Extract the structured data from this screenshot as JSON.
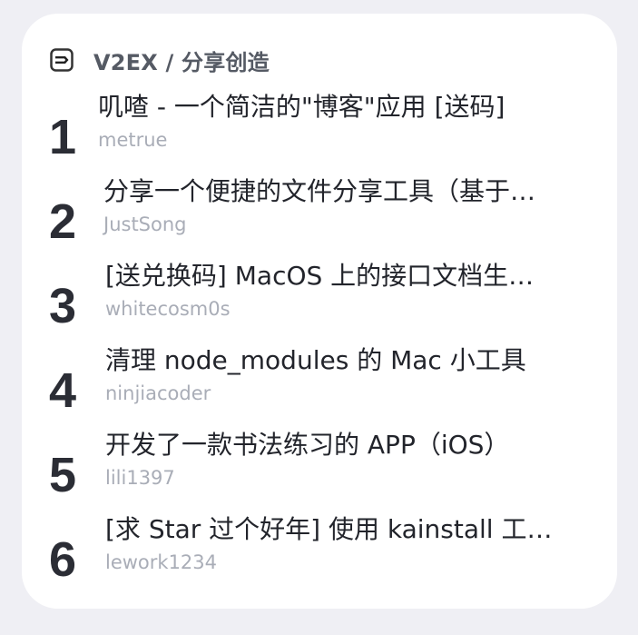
{
  "header": {
    "icon": "v2ex-logo-icon",
    "title": "V2EX / 分享创造"
  },
  "items": [
    {
      "rank": "1",
      "title": "叽喳 - 一个简洁的\"博客\"应用 [送码]",
      "author": "metrue"
    },
    {
      "rank": "2",
      "title": "分享一个便捷的文件分享工具（基于…",
      "author": "JustSong"
    },
    {
      "rank": "3",
      "title": "[送兑换码] MacOS 上的接口文档生…",
      "author": "whitecosm0s"
    },
    {
      "rank": "4",
      "title": "清理 node_modules 的 Mac 小工具",
      "author": "ninjiacoder"
    },
    {
      "rank": "5",
      "title": "开发了一款书法练习的 APP（iOS）",
      "author": "lili1397"
    },
    {
      "rank": "6",
      "title": "[求 Star 过个好年] 使用 kainstall 工…",
      "author": "lework1234"
    }
  ]
}
